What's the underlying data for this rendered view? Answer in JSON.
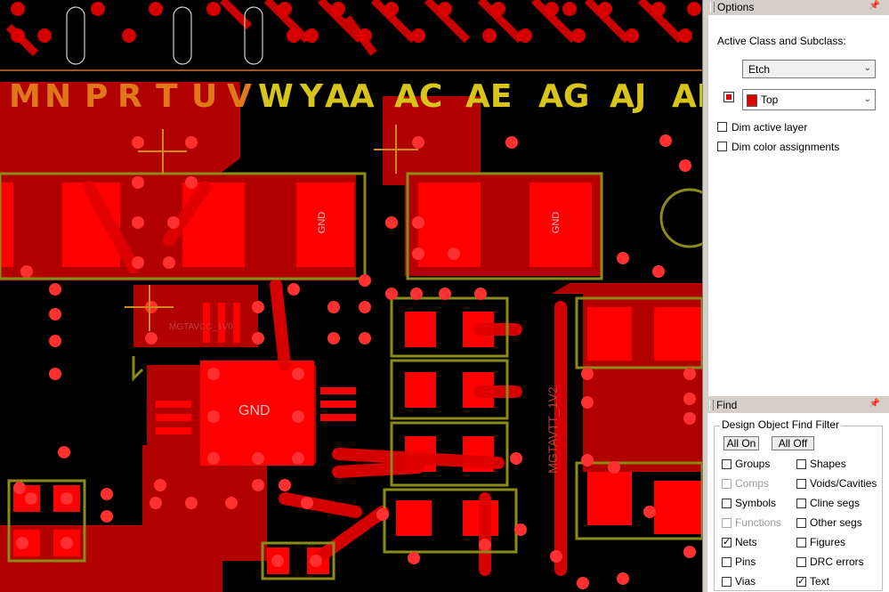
{
  "canvas": {
    "grid_labels": [
      "M",
      "N",
      "P",
      "R",
      "T",
      "U",
      "V",
      "W",
      "Y",
      "AA",
      "AC",
      "AE",
      "AG",
      "AJ",
      "AL"
    ],
    "pad_labels": {
      "gnd": "GND",
      "mgtavtt": "MGTAVTT_1V2",
      "mgtavcc": "MGTAVCC_1V0"
    },
    "colors": {
      "etch": "#e00000",
      "outline": "#8b8b1a",
      "label_yellow": "#d7c51a",
      "label_orange": "#e0781a",
      "background": "#000000"
    }
  },
  "options": {
    "title": "Options",
    "section_label": "Active Class and Subclass:",
    "class_value": "Etch",
    "subclass_value": "Top",
    "dim_active_layer": "Dim active layer",
    "dim_color_assignments": "Dim color assignments"
  },
  "find": {
    "title": "Find",
    "group_caption": "Design Object Find Filter",
    "all_on": "All On",
    "all_off": "All Off",
    "left": [
      {
        "label": "Groups",
        "checked": false,
        "enabled": true
      },
      {
        "label": "Comps",
        "checked": false,
        "enabled": false
      },
      {
        "label": "Symbols",
        "checked": false,
        "enabled": true
      },
      {
        "label": "Functions",
        "checked": false,
        "enabled": false
      },
      {
        "label": "Nets",
        "checked": true,
        "enabled": true
      },
      {
        "label": "Pins",
        "checked": false,
        "enabled": true
      },
      {
        "label": "Vias",
        "checked": false,
        "enabled": true
      }
    ],
    "right": [
      {
        "label": "Shapes",
        "checked": false,
        "enabled": true
      },
      {
        "label": "Voids/Cavities",
        "checked": false,
        "enabled": true
      },
      {
        "label": "Cline segs",
        "checked": false,
        "enabled": true
      },
      {
        "label": "Other segs",
        "checked": false,
        "enabled": true
      },
      {
        "label": "Figures",
        "checked": false,
        "enabled": true
      },
      {
        "label": "DRC errors",
        "checked": false,
        "enabled": true
      },
      {
        "label": "Text",
        "checked": true,
        "enabled": true
      }
    ]
  }
}
